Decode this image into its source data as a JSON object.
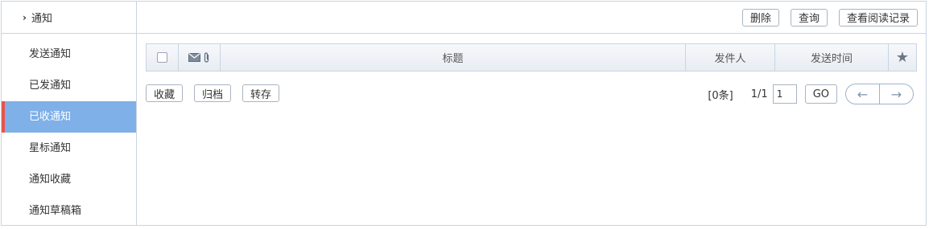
{
  "sidebar": {
    "header": "通知",
    "items": [
      {
        "label": "发送通知"
      },
      {
        "label": "已发通知"
      },
      {
        "label": "已收通知",
        "active": true
      },
      {
        "label": "星标通知"
      },
      {
        "label": "通知收藏"
      },
      {
        "label": "通知草稿箱"
      }
    ]
  },
  "toolbar": {
    "delete_label": "删除",
    "query_label": "查询",
    "read_records_label": "查看阅读记录"
  },
  "table": {
    "columns": {
      "title": "标题",
      "sender": "发件人",
      "send_time": "发送时间"
    },
    "icons": [
      "envelope-icon",
      "attachment-icon",
      "star-icon"
    ]
  },
  "actions": {
    "favorite_label": "收藏",
    "archive_label": "归档",
    "forward_label": "转存"
  },
  "pagination": {
    "count_text": "[0条]",
    "pages_text": "1/1",
    "page_input_value": "1",
    "go_label": "GO"
  },
  "colors": {
    "active_bg": "#7fb0e8",
    "active_marker": "#e8544b",
    "border": "#c9d4e2"
  }
}
